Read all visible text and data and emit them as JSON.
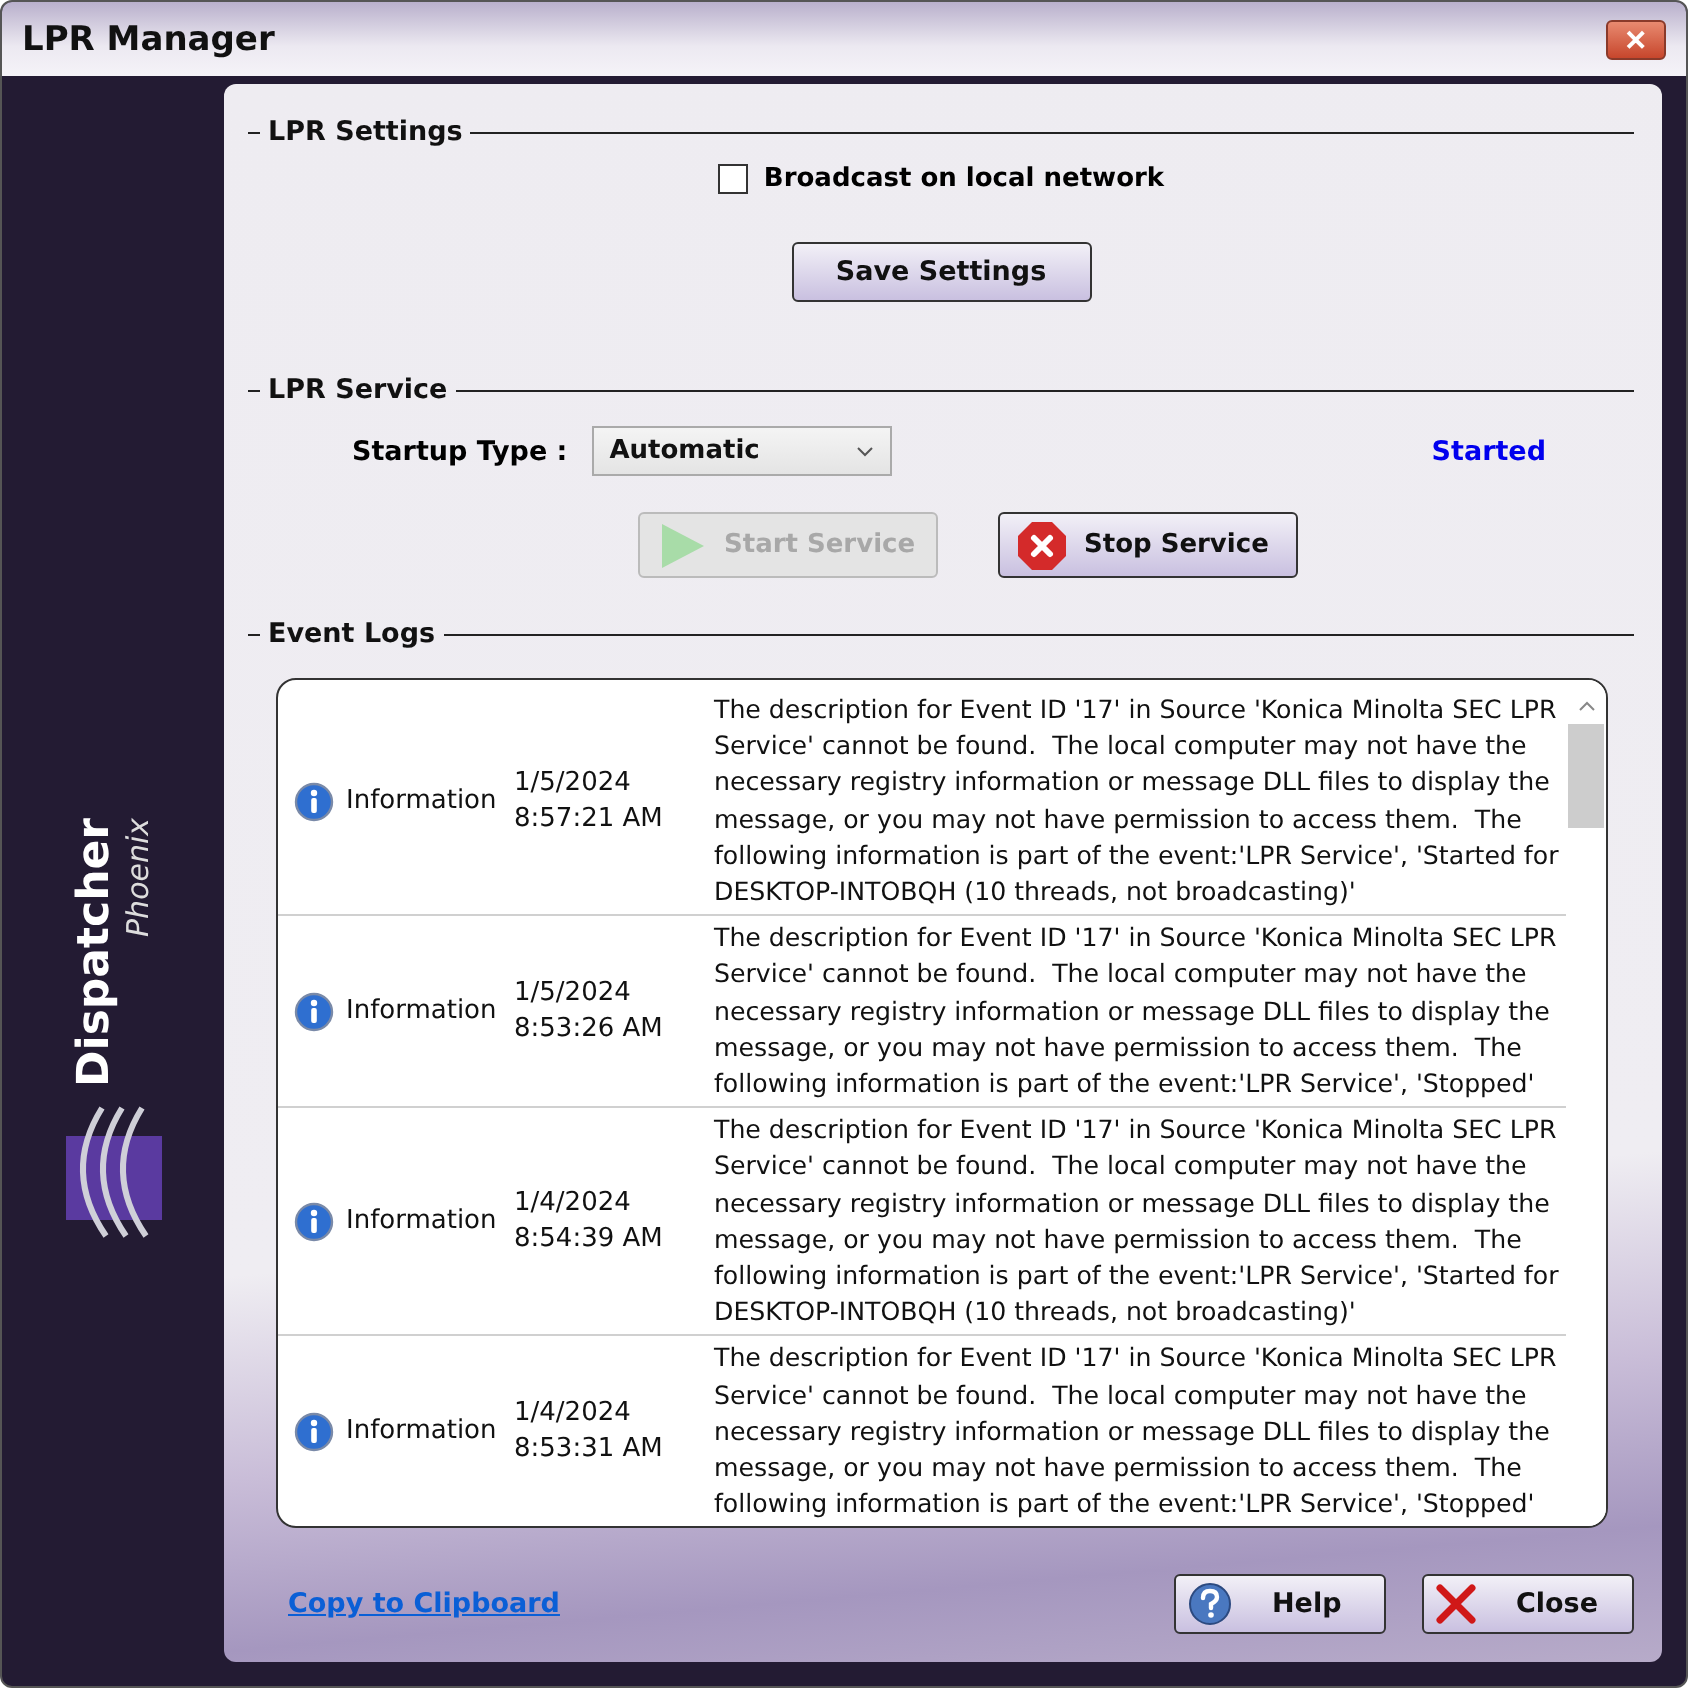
{
  "window": {
    "title": "LPR Manager",
    "close_label": "✕"
  },
  "branding": {
    "name": "Dispatcher",
    "subname": "Phoenix"
  },
  "settings": {
    "heading": "LPR Settings",
    "broadcast": {
      "label": "Broadcast on local network",
      "checked": false
    },
    "save_button": "Save Settings"
  },
  "service": {
    "heading": "LPR Service",
    "startup_label": "Startup Type :",
    "startup_value": "Automatic",
    "status": "Started",
    "buttons": [
      {
        "kind": "start",
        "label": "Start Service",
        "disabled": true
      },
      {
        "kind": "stop",
        "label": "Stop Service",
        "disabled": false
      }
    ]
  },
  "event_logs": {
    "heading": "Event Logs",
    "rows": [
      {
        "level": "Information",
        "date": "1/5/2024",
        "time": "8:57:21 AM",
        "message": "The description for Event ID '17' in Source 'Konica Minolta SEC LPR Service' cannot be found.  The local computer may not have the necessary registry information or message DLL files to display the message, or you may not have permission to access them.  The following information is part of the event:'LPR Service', 'Started for DESKTOP-INTOBQH (10 threads, not broadcasting)'"
      },
      {
        "level": "Information",
        "date": "1/5/2024",
        "time": "8:53:26 AM",
        "message": "The description for Event ID '17' in Source 'Konica Minolta SEC LPR Service' cannot be found.  The local computer may not have the necessary registry information or message DLL files to display the message, or you may not have permission to access them.  The following information is part of the event:'LPR Service', 'Stopped'"
      },
      {
        "level": "Information",
        "date": "1/4/2024",
        "time": "8:54:39 AM",
        "message": "The description for Event ID '17' in Source 'Konica Minolta SEC LPR Service' cannot be found.  The local computer may not have the necessary registry information or message DLL files to display the message, or you may not have permission to access them.  The following information is part of the event:'LPR Service', 'Started for DESKTOP-INTOBQH (10 threads, not broadcasting)'"
      },
      {
        "level": "Information",
        "date": "1/4/2024",
        "time": "8:53:31 AM",
        "message": "The description for Event ID '17' in Source 'Konica Minolta SEC LPR Service' cannot be found.  The local computer may not have the necessary registry information or message DLL files to display the message, or you may not have permission to access them.  The following information is part of the event:'LPR Service', 'Stopped'"
      }
    ]
  },
  "footer": {
    "link": "Copy to Clipboard",
    "buttons": [
      {
        "kind": "help",
        "label": "Help"
      },
      {
        "kind": "close",
        "label": "Close"
      }
    ]
  }
}
